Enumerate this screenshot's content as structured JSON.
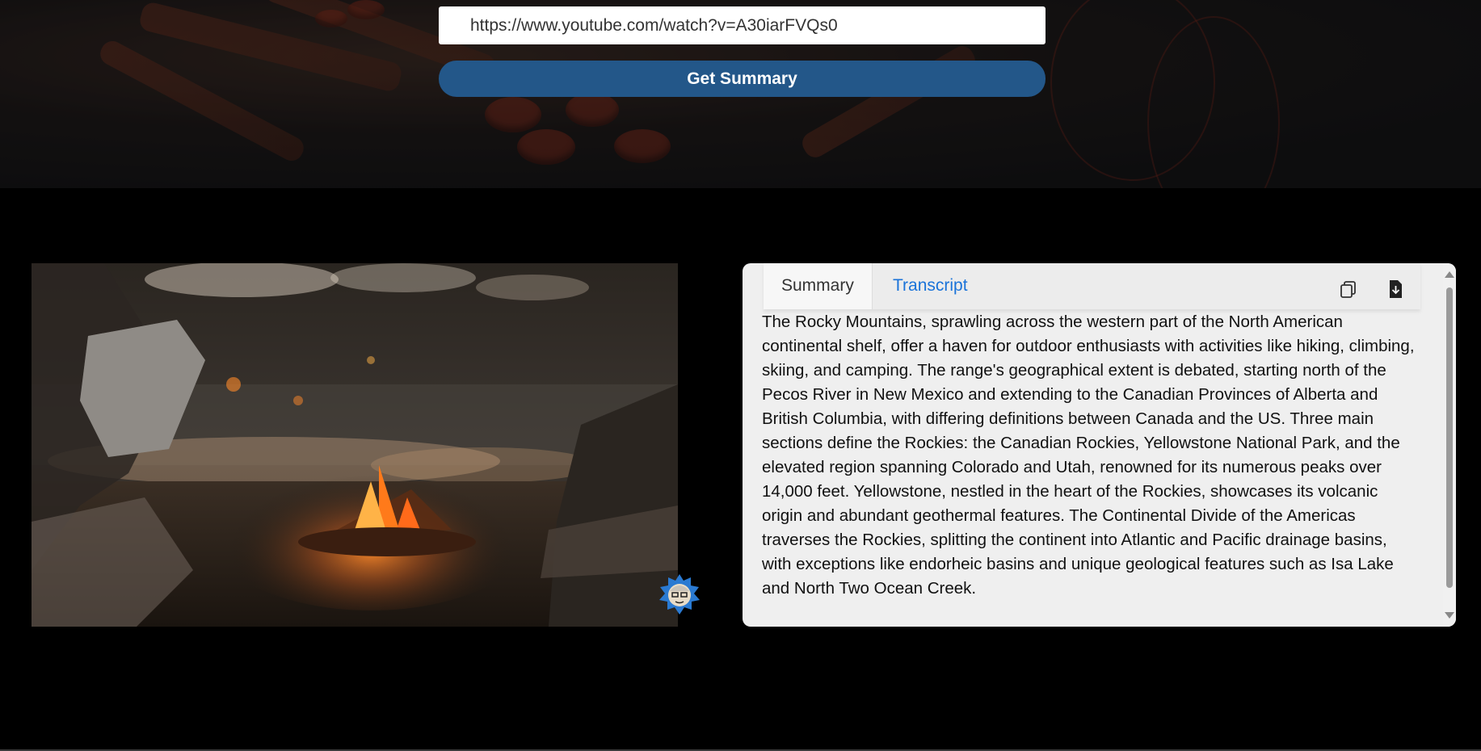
{
  "hero": {
    "url_value": "https://www.youtube.com/watch?v=A30iarFVQs0",
    "button_label": "Get Summary"
  },
  "video": {
    "scene": "campfire-thumbnail",
    "avatar_icon": "cartoon-avatar-icon"
  },
  "panel": {
    "tabs": [
      {
        "label": "Summary",
        "active": true
      },
      {
        "label": "Transcript",
        "active": false
      }
    ],
    "copy_icon": "copy-icon",
    "download_icon": "download-file-icon",
    "summary_text": "The Rocky Mountains, sprawling across the western part of the North American continental shelf, offer a haven for outdoor enthusiasts with activities like hiking, climbing, skiing, and camping. The range's geographical extent is debated, starting north of the Pecos River in New Mexico and extending to the Canadian Provinces of Alberta and British Columbia, with differing definitions between Canada and the US. Three main sections define the Rockies: the Canadian Rockies, Yellowstone National Park, and the elevated region spanning Colorado and Utah, renowned for its numerous peaks over 14,000 feet. Yellowstone, nestled in the heart of the Rockies, showcases its volcanic origin and abundant geothermal features. The Continental Divide of the Americas traverses the Rockies, splitting the continent into Atlantic and Pacific drainage basins, with exceptions like endorheic basins and unique geological features such as Isa Lake and North Two Ocean Creek."
  },
  "colors": {
    "button_bg": "#235789",
    "tab_active_text": "#333333",
    "tab_inactive_text": "#1a73d9",
    "panel_bg": "#efefef"
  }
}
